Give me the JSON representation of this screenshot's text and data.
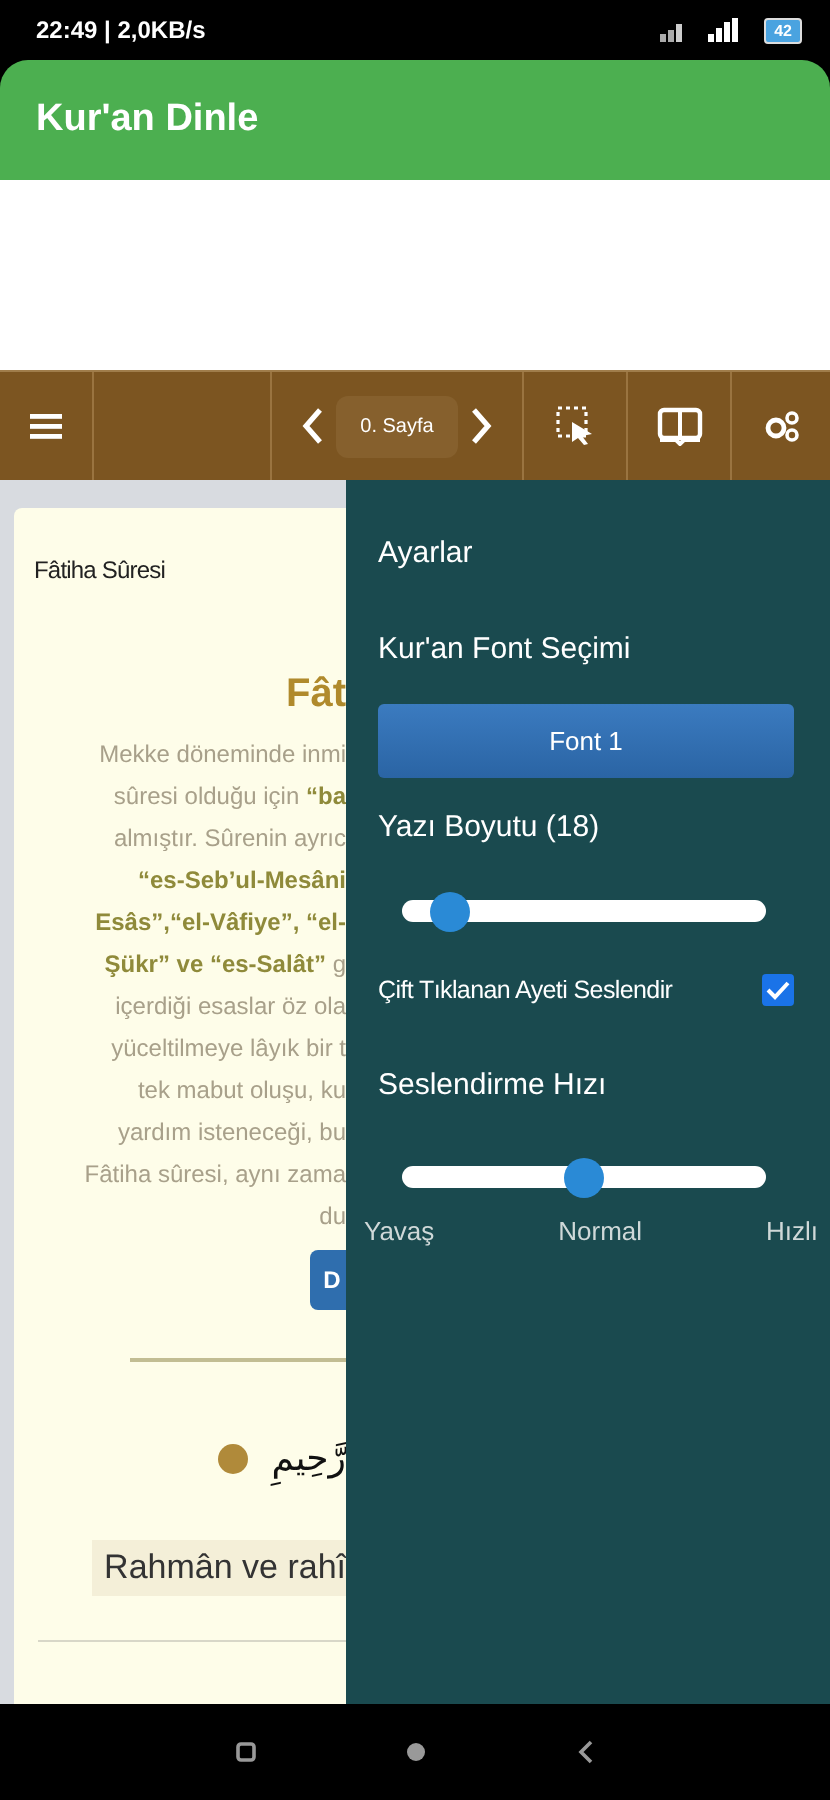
{
  "status_bar": {
    "time": "22:49 | 2,0KB/s",
    "battery": "42"
  },
  "app_bar": {
    "title": "Kur'an Dinle"
  },
  "toolbar": {
    "page": "0. Sayfa"
  },
  "content": {
    "card_title": "Fâtiha Sûresi",
    "heading": "Fât",
    "intro_lines": [
      {
        "text": "Mekke döneminde inmi",
        "kind": "plain"
      },
      {
        "text": "sûresi olduğu için **“ba**",
        "kind": "plain"
      },
      {
        "text": "almıştır. Sûrenin ayrıc",
        "kind": "plain"
      },
      {
        "text": "“es-Seb’ul-Mesâni",
        "kind": "bold"
      },
      {
        "text": "Esâs”,“el-Vâfiye”, “el-",
        "kind": "bold"
      },
      {
        "text": "**Şükr” ve “es-Salât”** g",
        "kind": "plain"
      },
      {
        "text": "içerdiği esaslar öz ola",
        "kind": "plain"
      },
      {
        "text": "yüceltilmeye lâyık bir t",
        "kind": "plain"
      },
      {
        "text": "tek mabut oluşu, ku",
        "kind": "plain"
      },
      {
        "text": "yardım isteneceği, bu",
        "kind": "plain"
      },
      {
        "text": "Fâtiha sûresi, aynı zama",
        "kind": "plain"
      },
      {
        "text": "du",
        "kind": "plain"
      }
    ],
    "button": "D",
    "verse": {
      "arabic": "رَّحِيمِ",
      "translation": "Rahmân ve rahî"
    }
  },
  "settings": {
    "title": "Ayarlar",
    "font_label": "Kur'an Font Seçimi",
    "font_button": "Font 1",
    "size_label": "Yazı Boyutu (18)",
    "size_slider": {
      "level": 0.13
    },
    "double_tap": {
      "label": "Çift Tıklanan Ayeti Seslendir",
      "checked": true
    },
    "speed_label": "Seslendirme Hızı",
    "speed_slider": {
      "level": 0.5
    },
    "speed_marks": [
      "Yavaş",
      "Normal",
      "Hızlı"
    ]
  }
}
